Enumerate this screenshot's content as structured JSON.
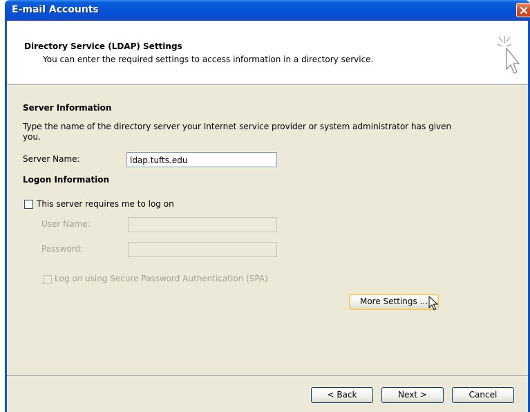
{
  "window": {
    "title": "E-mail Accounts"
  },
  "header": {
    "title": "Directory Service (LDAP) Settings",
    "subtitle": "You can enter the required settings to access information in a directory service.",
    "icon": "cursor-sparkle-icon"
  },
  "server_info": {
    "heading": "Server Information",
    "description": "Type the name of the directory server your Internet service provider or system administrator has given you.",
    "server_name_label": "Server Name:",
    "server_name_value": "ldap.tufts.edu"
  },
  "logon_info": {
    "heading": "Logon Information",
    "requires_logon_label": "This server requires me to log on",
    "requires_logon_checked": false,
    "user_name_label": "User Name:",
    "user_name_value": "",
    "password_label": "Password:",
    "password_value": "",
    "spa_label": "Log on using Secure Password Authentication (SPA)",
    "spa_checked": false
  },
  "buttons": {
    "more_settings": "More Settings ...",
    "back": "< Back",
    "next": "Next >",
    "cancel": "Cancel"
  },
  "colors": {
    "titlebar": "#0453d6",
    "dialog_bg": "#ece9d8",
    "close_button": "#d9512a",
    "focus_border": "#f3c248"
  }
}
